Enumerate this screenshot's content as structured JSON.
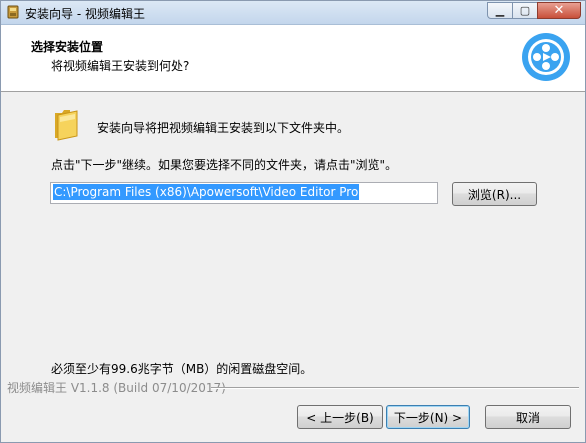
{
  "window": {
    "title": "安装向导 - 视频编辑王",
    "minimize_glyph": "▁",
    "maximize_glyph": "▢",
    "close_glyph": "✕"
  },
  "header": {
    "title": "选择安装位置",
    "subtitle": "将视频编辑王安装到何处?"
  },
  "content": {
    "intro": "安装向导将把视频编辑王安装到以下文件夹中。",
    "instruction": "点击\"下一步\"继续。如果您要选择不同的文件夹，请点击\"浏览\"。",
    "path_value": "C:\\Program Files (x86)\\Apowersoft\\Video Editor Pro",
    "browse_label": "浏览(R)...",
    "space_requirement": "必须至少有99.6兆字节（MB）的闲置磁盘空间。"
  },
  "footer": {
    "version": "视频编辑王 V1.1.8  (Build 07/10/2017)",
    "back_label": "< 上一步(B)",
    "next_label": "下一步(N) >",
    "cancel_label": "取消"
  },
  "colors": {
    "accent": "#3399ff",
    "logo": "#3aa3f0"
  }
}
